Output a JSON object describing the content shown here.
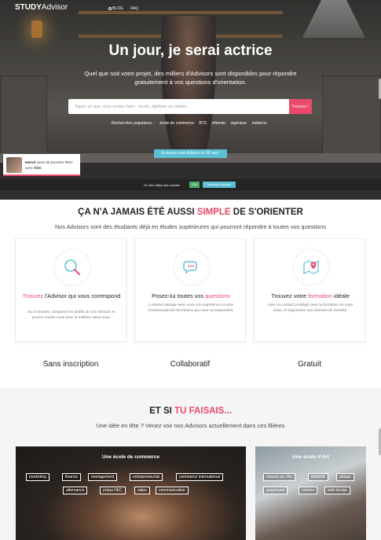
{
  "nav": {
    "logo_study": "STUDY",
    "logo_advisor": "Advisor",
    "blog": "BLOG",
    "faq": "FAQ"
  },
  "hero": {
    "title": "Un jour, je serai actrice",
    "subtitle": "Quel que soit votre projet, des milliers d'Advisors sont disponibles pour répondre gratuitement à vos questions d'orientation.",
    "search_placeholder": "Tapez ce que vous voulez faire : école, diplôme ou métier...",
    "search_button": "Trouver !",
    "popular_label": "Recherches populaires :",
    "popular": [
      "école de commerce",
      "BTS",
      "infirmier",
      "ingénieur",
      "médecin"
    ],
    "cta": "Je trouve mon Advisor en 30 sec !"
  },
  "notification": {
    "name": "Hervé",
    "text": " vient de prendre RDV avec ",
    "with": "Kim"
  },
  "cookie": {
    "text": "Ce site utilise des cookies",
    "ok": "OK",
    "more": "Mentions légales"
  },
  "section_simple": {
    "title_before": "ÇA N'A JAMAIS ÉTÉ AUSSI ",
    "title_highlight": "SIMPLE",
    "title_after": " DE S'ORIENTER",
    "subtitle": "Nos Advisors sont des étudiants déjà en études supérieures qui pourront répondre à toutes vos questions",
    "cards": [
      {
        "title_highlight": "Trouvez",
        "title_rest": " l'Advisor qui vous correspond",
        "text": "En 5 minutes, comparez les profils de nos Advisors et prenez rendez-vous avec le meilleur selon vous."
      },
      {
        "title_before": "Posez-lui toutes vos ",
        "title_highlight": "questions",
        "text": "L'Advisor partage avec vous son expérience et vous recommande les formations qui vous correspondent."
      },
      {
        "title_before": "Trouvez votre ",
        "title_highlight": "formation",
        "title_after": " idéale",
        "text": "Ayez un contact privilégié avec la formation de votre choix, et augmentez vos chances de réussite."
      }
    ],
    "features": [
      "Sans inscription",
      "Collaboratif",
      "Gratuit"
    ]
  },
  "section_si": {
    "title_before": "ET SI ",
    "title_highlight": "TU FAISAIS...",
    "subtitle": "Une idée en tête ? Venez voir nos Advisors actuellement dans ces filières",
    "panels": [
      {
        "title": "Une école de commerce",
        "tags": [
          "marketing",
          "finance",
          "management",
          "entrepreneuriat",
          "commerce international",
          "alternance",
          "prépa HEC",
          "sales",
          "communication"
        ]
      },
      {
        "title": "Une école d'Art",
        "tags": [
          "histoire de l'Art",
          "MANAA",
          "design",
          "graphisme",
          "cinéma",
          "web design"
        ]
      }
    ]
  },
  "colors": {
    "accent": "#e9496b",
    "cyan": "#5cc0d4",
    "ok": "#4caf6b"
  },
  "icons": [
    "search-icon",
    "chat-icon",
    "location-pin-icon",
    "blog-icon"
  ]
}
